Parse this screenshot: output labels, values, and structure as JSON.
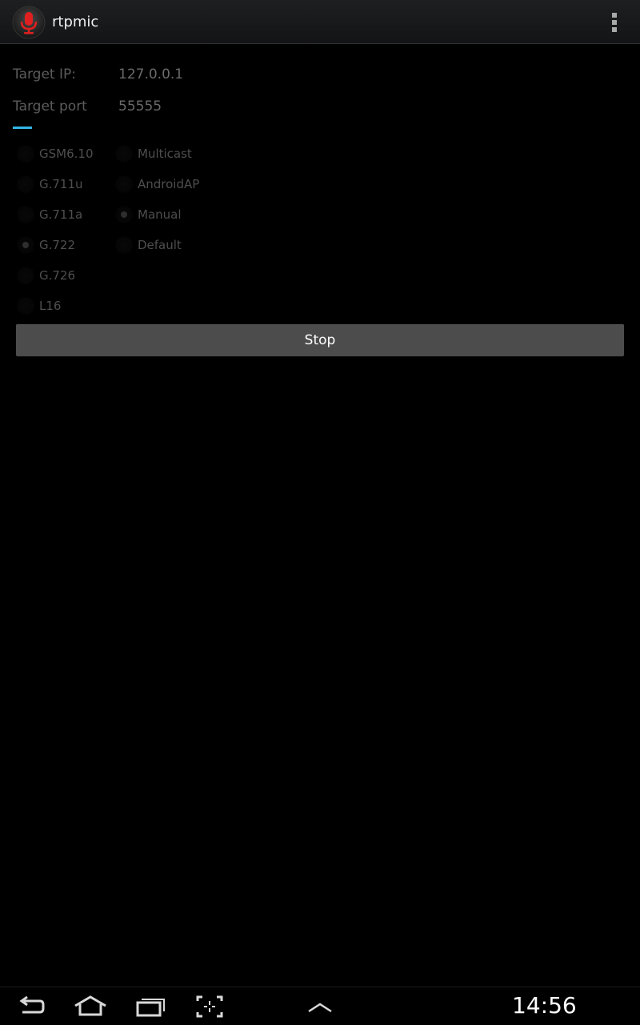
{
  "app": {
    "title": "rtpmic",
    "icon": "microphone-icon"
  },
  "action_bar": {
    "overflow_icon": "overflow-menu-icon"
  },
  "form": {
    "target_ip": {
      "label": "Target IP:",
      "value": "127.0.0.1"
    },
    "target_port": {
      "label": "Target port",
      "value": "55555"
    }
  },
  "codecs": [
    {
      "label": "GSM6.10",
      "checked": false
    },
    {
      "label": "G.711u",
      "checked": false
    },
    {
      "label": "G.711a",
      "checked": false
    },
    {
      "label": "G.722",
      "checked": true
    },
    {
      "label": "G.726",
      "checked": false
    },
    {
      "label": "L16",
      "checked": false
    }
  ],
  "modes": [
    {
      "label": "Multicast",
      "checked": false
    },
    {
      "label": "AndroidAP",
      "checked": false
    },
    {
      "label": "Manual",
      "checked": true
    },
    {
      "label": "Default",
      "checked": false
    }
  ],
  "stop_button": {
    "label": "Stop"
  },
  "navbar": {
    "icons": [
      "back-icon",
      "home-icon",
      "recent-apps-icon",
      "screenshot-icon",
      "up-arrow-icon"
    ],
    "time": "14:56"
  },
  "colors": {
    "accent": "#33b5e5",
    "mic_red": "#e02020",
    "button_bg": "#4c4c4c"
  }
}
